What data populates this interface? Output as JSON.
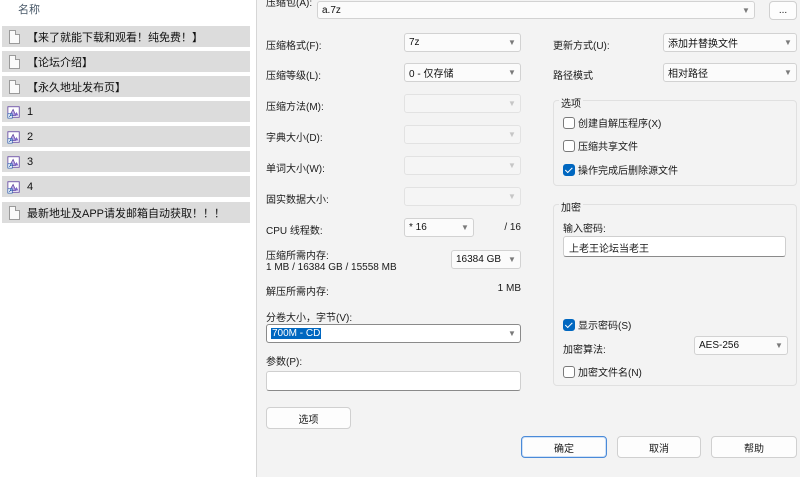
{
  "explorer": {
    "column_header": "名称",
    "rows": [
      {
        "name": "【来了就能下载和观看！纯免费！】",
        "icon": "document-icon"
      },
      {
        "name": "【论坛介绍】",
        "icon": "document-icon"
      },
      {
        "name": "【永久地址发布页】",
        "icon": "document-icon"
      },
      {
        "name": "1",
        "icon": "shortcut-icon"
      },
      {
        "name": "2",
        "icon": "shortcut-icon"
      },
      {
        "name": "3",
        "icon": "shortcut-icon"
      },
      {
        "name": "4",
        "icon": "shortcut-icon"
      },
      {
        "name": "最新地址及APP请发邮箱自动获取！！！",
        "icon": "document-icon"
      }
    ]
  },
  "dialog": {
    "archive_label": "压缩包(A):",
    "archive_value": "a.7z",
    "browse_label": "...",
    "format_label": "压缩格式(F):",
    "format_value": "7z",
    "level_label": "压缩等级(L):",
    "level_value": "0 - 仅存储",
    "method_label": "压缩方法(M):",
    "dict_label": "字典大小(D):",
    "word_label": "单词大小(W):",
    "solid_label": "固实数据大小:",
    "threads_label": "CPU 线程数:",
    "threads_value": "* 16",
    "threads_total": "/ 16",
    "mem_comp_label": "压缩所需内存:",
    "mem_comp_detail": "1 MB / 16384 GB / 15558 MB",
    "mem_comp_value": "16384 GB",
    "mem_decomp_label": "解压所需内存:",
    "mem_decomp_value": "1 MB",
    "split_label": "分卷大小，字节(V):",
    "split_value": "700M - CD",
    "params_label": "参数(P):",
    "params_value": "",
    "options_button": "选项",
    "update_label": "更新方式(U):",
    "update_value": "添加并替换文件",
    "path_label": "路径模式",
    "path_value": "相对路径",
    "options_group": {
      "title": "选项",
      "sfx": {
        "label": "创建自解压程序(X)",
        "checked": false
      },
      "shared": {
        "label": "压缩共享文件",
        "checked": false
      },
      "delete_after": {
        "label": "操作完成后删除源文件",
        "checked": true
      }
    },
    "encryption_group": {
      "title": "加密",
      "password_label": "输入密码:",
      "password_value": "上老王论坛当老王",
      "show_password": {
        "label": "显示密码(S)",
        "checked": true
      },
      "method_label": "加密算法:",
      "method_value": "AES-256",
      "encrypt_names": {
        "label": "加密文件名(N)",
        "checked": false
      }
    },
    "ok_button": "确定",
    "cancel_button": "取消",
    "help_button": "帮助"
  },
  "colors": {
    "accent": "#0067c0",
    "row_bg": "#dcdcdc",
    "dialog_bg": "#f3f3f3",
    "selection": "#0067c0"
  }
}
